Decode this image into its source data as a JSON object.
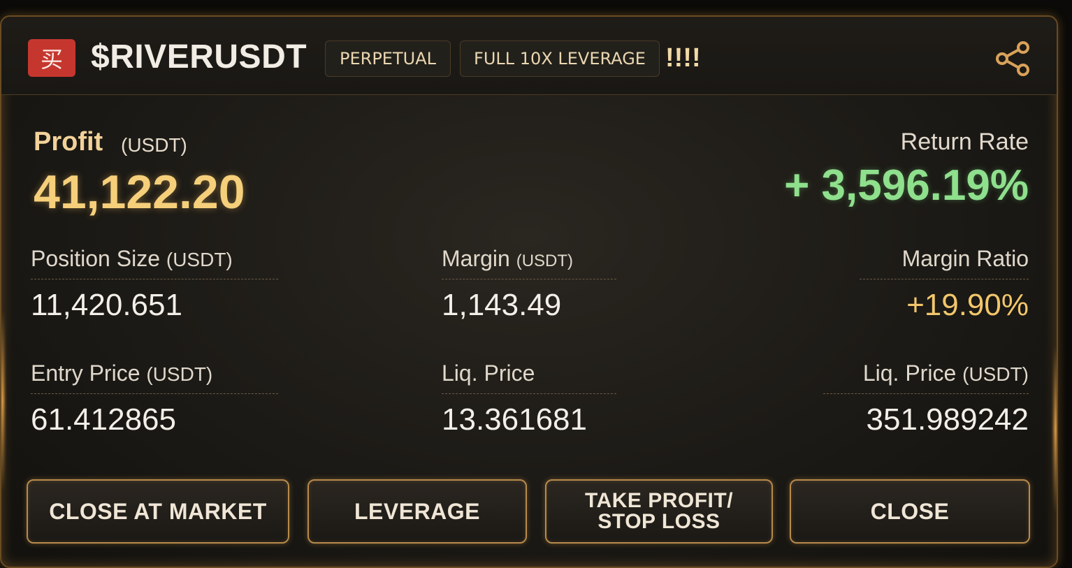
{
  "header": {
    "buy_badge": "买",
    "symbol": "$RIVERUSDT",
    "tag_perpetual": "PERPETUAL",
    "tag_leverage": "FULL 10X LEVERAGE",
    "exclaim": "!!!!",
    "share_icon": "share-icon"
  },
  "profit": {
    "label": "Profit",
    "unit": "(USDT)",
    "value": "41,122.20"
  },
  "return_rate": {
    "label": "Return Rate",
    "value": "+ 3,596.19%"
  },
  "stats": {
    "position_size": {
      "label": "Position Size",
      "unit": "(USDT)",
      "value": "11,420.651"
    },
    "margin": {
      "label": "Margin",
      "unit": "(USDT)",
      "value": "1,143.49"
    },
    "margin_ratio": {
      "label": "Margin Ratio",
      "value": "+19.90%"
    },
    "entry_price": {
      "label": "Entry Price",
      "unit": "(USDT)",
      "value": "61.412865"
    },
    "liq_price": {
      "label": "Liq. Price",
      "value": "13.361681"
    },
    "liq_price_usdt": {
      "label": "Liq. Price",
      "unit": "(USDT)",
      "value": "351.989242"
    }
  },
  "buttons": {
    "close_at_market": "CLOSE AT MARKET",
    "leverage": "LEVERAGE",
    "tp_line1": "TAKE PROFIT/",
    "tp_line2": "STOP LOSS",
    "close": "CLOSE"
  },
  "colors": {
    "profit": "#f6cf7b",
    "return_rate": "#8fe08d",
    "buy_badge": "#c5372e",
    "button_border": "#b78a4b"
  }
}
